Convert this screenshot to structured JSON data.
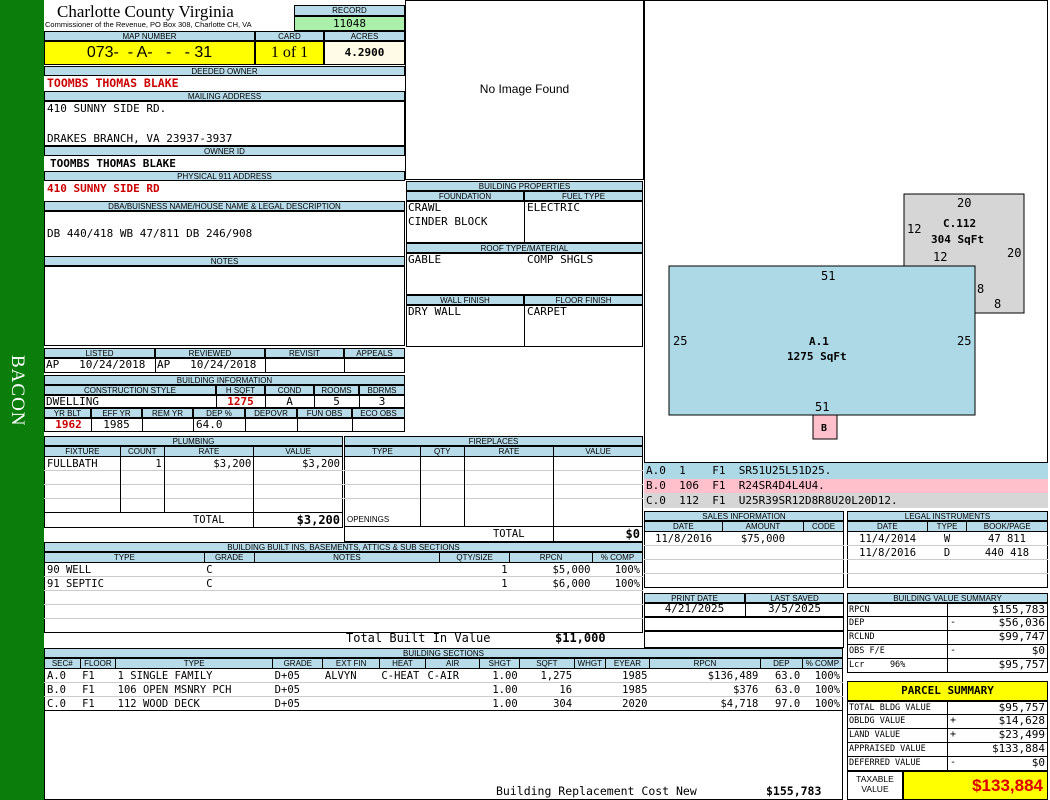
{
  "sidebar": {
    "label": "BACON"
  },
  "header": {
    "county": "Charlotte County Virginia",
    "commissioner": "Commissioner of the Revenue, PO Box 308, Charlotte CH, VA",
    "record_label": "RECORD",
    "record": "11048",
    "map_label": "MAP NUMBER",
    "map": "073-  - A-   -   - 31",
    "card_label": "CARD",
    "card": "1 of 1",
    "acres_label": "ACRES",
    "acres": "4.2900"
  },
  "owner": {
    "deeded_label": "DEEDED OWNER",
    "deeded": "TOOMBS THOMAS BLAKE",
    "mailing_label": "MAILING ADDRESS",
    "mailing1": "410 SUNNY SIDE RD.",
    "mailing2": "DRAKES BRANCH, VA 23937-3937",
    "ownerid_label": "OWNER ID",
    "ownerid": "TOOMBS THOMAS BLAKE",
    "phys_label": "PHYSICAL 911 ADDRESS",
    "phys": "410 SUNNY SIDE RD",
    "dba_label": "DBA/BUISNESS NAME/HOUSE NAME & LEGAL DESCRIPTION",
    "dba": "DB 440/418 WB 47/811 DB 246/908",
    "notes_label": "NOTES"
  },
  "image": {
    "text": "No Image Found"
  },
  "props": {
    "title": "BUILDING PROPERTIES",
    "foundation_label": "FOUNDATION",
    "fuel_label": "FUEL TYPE",
    "foundation1": "CRAWL",
    "foundation2": "CINDER BLOCK",
    "fuel": "ELECTRIC",
    "roof_label": "ROOF TYPE/MATERIAL",
    "roof1": "GABLE",
    "roof2": "COMP SHGLS",
    "wall_label": "WALL FINISH",
    "floor_label": "FLOOR FINISH",
    "wall": "DRY WALL",
    "floor": "CARPET"
  },
  "dates": {
    "listed_label": "LISTED",
    "reviewed_label": "REVIEWED",
    "revisit_label": "REVISIT",
    "appeals_label": "APPEALS",
    "listed": "AP   10/24/2018",
    "reviewed": "AP   10/24/2018"
  },
  "bldinfo": {
    "title": "BUILDING INFORMATION",
    "style_label": "CONSTRUCTION STYLE",
    "hsqft_label": "H SQFT",
    "cond_label": "COND",
    "rooms_label": "ROOMS",
    "bdrms_label": "BDRMS",
    "style": "DWELLING",
    "hsqft": "1275",
    "cond": "A",
    "rooms": "5",
    "bdrms": "3",
    "yrblt_label": "YR BLT",
    "effyr_label": "EFF YR",
    "remyr_label": "REM YR",
    "dep_label": "DEP %",
    "depovr_label": "DEPOVR",
    "funobs_label": "FUN OBS",
    "ecoobs_label": "ECO OBS",
    "yrblt": "1962",
    "effyr": "1985",
    "dep": "64.0"
  },
  "plumbing": {
    "title": "PLUMBING",
    "cols": [
      "FIXTURE",
      "COUNT",
      "RATE",
      "VALUE"
    ],
    "rows": [
      [
        "FULLBATH",
        "1",
        "$3,200",
        "$3,200"
      ]
    ],
    "total_label": "TOTAL",
    "total": "$3,200"
  },
  "fireplaces": {
    "title": "FIREPLACES",
    "cols": [
      "TYPE",
      "QTY",
      "RATE",
      "VALUE"
    ],
    "openings_label": "OPENINGS",
    "total_label": "TOTAL",
    "total": "$0"
  },
  "builtins": {
    "title": "BUILDING BUILT INS, BASEMENTS, ATTICS & SUB SECTIONS",
    "cols": [
      "TYPE",
      "GRADE",
      "NOTES",
      "QTY/SIZE",
      "RPCN",
      "% COMP"
    ],
    "rows": [
      [
        "90 WELL",
        "C",
        "",
        "1",
        "$5,000",
        "100%"
      ],
      [
        "91 SEPTIC",
        "C",
        "",
        "1",
        "$6,000",
        "100%"
      ]
    ],
    "total_label": "Total Built In Value",
    "total": "$11,000"
  },
  "sections": {
    "title": "BUILDING SECTIONS",
    "cols": [
      "SEC#",
      "FLOOR",
      "TYPE",
      "GRADE",
      "EXT FIN",
      "HEAT",
      "AIR",
      "SHGT",
      "SQFT",
      "WHGT",
      "EYEAR",
      "RPCN",
      "DEP",
      "% COMP"
    ],
    "rows": [
      [
        "A.0",
        "F1",
        "1 SINGLE FAMILY",
        "D+05",
        "ALVYN",
        "C-HEAT",
        "C-AIR",
        "1.00",
        "1,275",
        "",
        "1985",
        "$136,489",
        "63.0",
        "100%"
      ],
      [
        "B.0",
        "F1",
        "106 OPEN MSNRY PCH",
        "D+05",
        "",
        "",
        "",
        "1.00",
        "16",
        "",
        "1985",
        "$376",
        "63.0",
        "100%"
      ],
      [
        "C.0",
        "F1",
        "112 WOOD DECK",
        "D+05",
        "",
        "",
        "",
        "1.00",
        "304",
        "",
        "2020",
        "$4,718",
        "97.0",
        "100%"
      ]
    ],
    "rcn_label": "Building Replacement Cost New",
    "rcn": "$155,783"
  },
  "sketch": {
    "labels": {
      "a_name": "A.1",
      "a_area": "1275 SqFt",
      "a_top": "51",
      "a_bottom": "51",
      "a_left": "25",
      "a_right": "25",
      "c_name": "C.112",
      "c_area": "304 SqFt",
      "c_top": "20",
      "c_left": "12",
      "c_inner": "12",
      "c_right": "20",
      "c_r1": "8",
      "c_r2": "8",
      "b_name": "B"
    },
    "lines": [
      "A.0  1    F1  SR51U25L51D25.",
      "B.0  106  F1  R24SR4D4L4U4.",
      "C.0  112  F1  U25R39SR12D8R8U20L20D12."
    ]
  },
  "sales": {
    "title": "SALES INFORMATION",
    "cols": [
      "DATE",
      "AMOUNT",
      "CODE"
    ],
    "rows": [
      [
        "11/8/2016",
        "$75,000",
        ""
      ]
    ]
  },
  "legal": {
    "title": "LEGAL INSTRUMENTS",
    "cols": [
      "DATE",
      "TYPE",
      "BOOK/PAGE"
    ],
    "rows": [
      [
        "11/4/2014",
        "W",
        "47 811"
      ],
      [
        "11/8/2016",
        "D",
        "440 418"
      ]
    ]
  },
  "print": {
    "print_label": "PRINT DATE",
    "saved_label": "LAST SAVED",
    "print": "4/21/2025",
    "saved": "3/5/2025"
  },
  "bvs": {
    "title": "BUILDING VALUE SUMMARY",
    "rows": [
      [
        "RPCN",
        "",
        "$155,783"
      ],
      [
        "DEP",
        "-",
        "$56,036"
      ],
      [
        "RCLND",
        "",
        "$99,747"
      ],
      [
        "OBS F/E",
        "-",
        "$0"
      ],
      [
        "Lcr     96%",
        "",
        "$95,757"
      ]
    ]
  },
  "parcel": {
    "title": "PARCEL SUMMARY",
    "rows": [
      [
        "TOTAL BLDG VALUE",
        "",
        "$95,757"
      ],
      [
        "OBLDG VALUE",
        "+",
        "$14,628"
      ],
      [
        "LAND VALUE",
        "+",
        "$23,499"
      ],
      [
        "APPRAISED VALUE",
        "",
        "$133,884"
      ],
      [
        "DEFERRED VALUE",
        "-",
        "$0"
      ]
    ],
    "taxable_label1": "TAXABLE",
    "taxable_label2": "VALUE",
    "taxable": "$133,884"
  }
}
